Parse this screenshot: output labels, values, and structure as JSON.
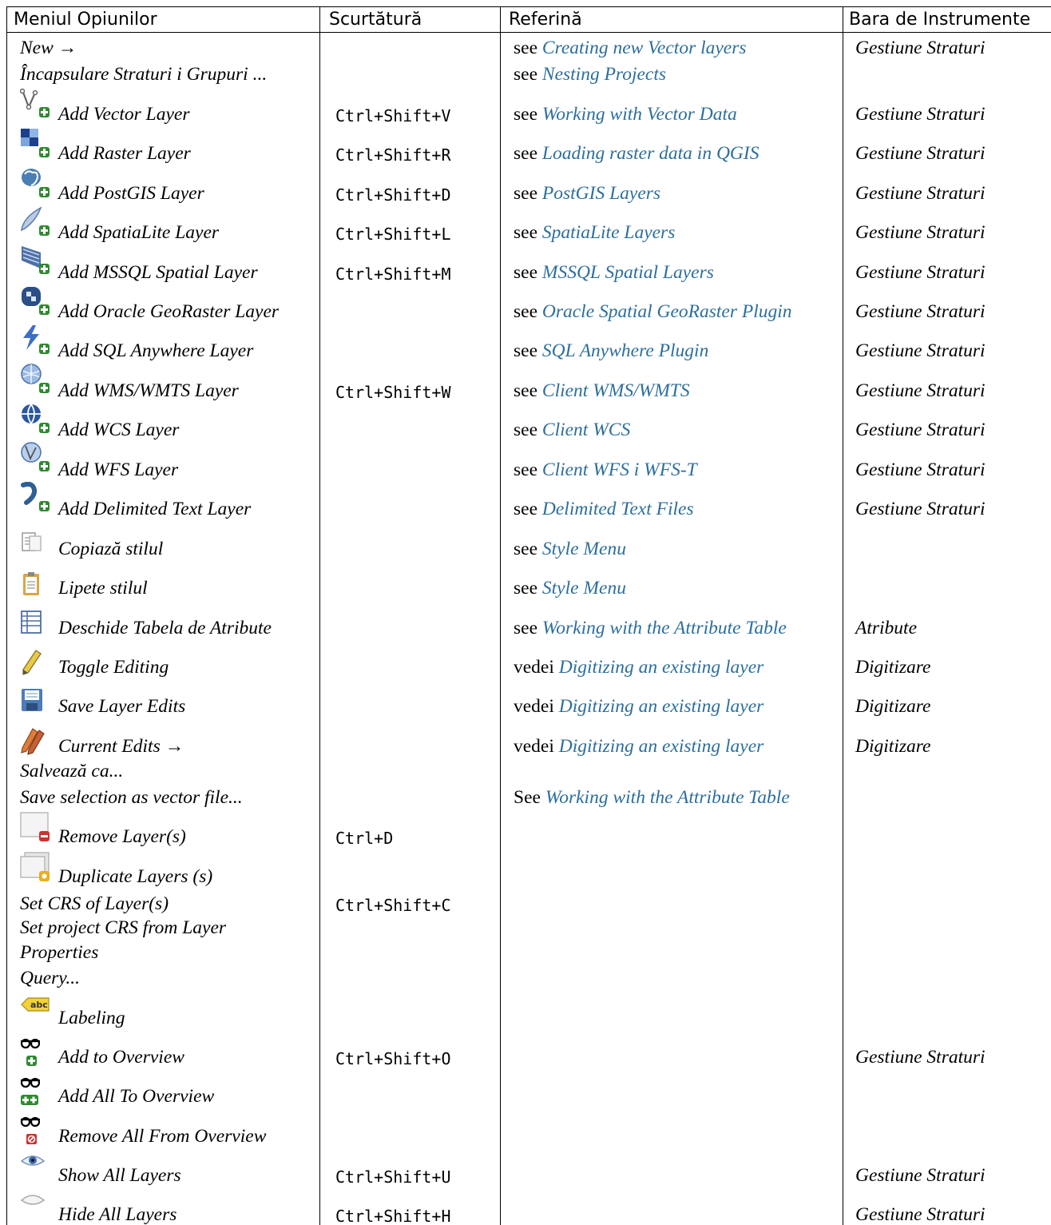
{
  "header": {
    "col1": "Meniul Opiunilor",
    "col2": "Scurtătură",
    "col3": "Referină",
    "col4": "Bara de Instrumente"
  },
  "rows": [
    {
      "label": "New →",
      "shortcut": "",
      "ref_prefix": "see",
      "ref_link": "Creating new Vector layers",
      "toolbar": "Gestiune Straturi",
      "icon": ""
    },
    {
      "label": "Încapsulare Straturi i Grupuri ...",
      "shortcut": "",
      "ref_prefix": "see",
      "ref_link": "Nesting Projects",
      "toolbar": "",
      "icon": ""
    },
    {
      "label": "Add Vector Layer",
      "shortcut": "Ctrl+Shift+V",
      "ref_prefix": "see",
      "ref_link": "Working with Vector Data",
      "toolbar": "Gestiune Straturi",
      "icon": "add-vector-layer-icon"
    },
    {
      "label": "Add Raster Layer",
      "shortcut": "Ctrl+Shift+R",
      "ref_prefix": "see",
      "ref_link": "Loading raster data in QGIS",
      "toolbar": "Gestiune Straturi",
      "icon": "add-raster-layer-icon"
    },
    {
      "label": "Add PostGIS Layer",
      "shortcut": "Ctrl+Shift+D",
      "ref_prefix": "see",
      "ref_link": "PostGIS Layers",
      "toolbar": "Gestiune Straturi",
      "icon": "add-postgis-layer-icon"
    },
    {
      "label": "Add SpatiaLite Layer",
      "shortcut": "Ctrl+Shift+L",
      "ref_prefix": "see",
      "ref_link": "SpatiaLite Layers",
      "toolbar": "Gestiune Straturi",
      "icon": "add-spatialite-layer-icon"
    },
    {
      "label": "Add MSSQL Spatial Layer",
      "shortcut": "Ctrl+Shift+M",
      "ref_prefix": "see",
      "ref_link": "MSSQL Spatial Layers",
      "toolbar": "Gestiune Straturi",
      "icon": "add-mssql-layer-icon"
    },
    {
      "label": "Add Oracle GeoRaster Layer",
      "shortcut": "",
      "ref_prefix": "see",
      "ref_link": "Oracle Spatial GeoRaster Plugin",
      "toolbar": "Gestiune Straturi",
      "icon": "add-oracle-georaster-layer-icon"
    },
    {
      "label": "Add SQL Anywhere Layer",
      "shortcut": "",
      "ref_prefix": "see",
      "ref_link": "SQL Anywhere Plugin",
      "toolbar": "Gestiune Straturi",
      "icon": "add-sql-anywhere-layer-icon"
    },
    {
      "label": "Add WMS/WMTS Layer",
      "shortcut": "Ctrl+Shift+W",
      "ref_prefix": "see",
      "ref_link": "Client WMS/WMTS",
      "toolbar": "Gestiune Straturi",
      "icon": "add-wms-layer-icon"
    },
    {
      "label": "Add WCS Layer",
      "shortcut": "",
      "ref_prefix": "see",
      "ref_link": "Client WCS",
      "toolbar": "Gestiune Straturi",
      "icon": "add-wcs-layer-icon"
    },
    {
      "label": "Add WFS Layer",
      "shortcut": "",
      "ref_prefix": "see",
      "ref_link": "Client WFS i WFS-T",
      "toolbar": "Gestiune Straturi",
      "icon": "add-wfs-layer-icon"
    },
    {
      "label": "Add Delimited Text Layer",
      "shortcut": "",
      "ref_prefix": "see",
      "ref_link": "Delimited Text Files",
      "toolbar": "Gestiune Straturi",
      "icon": "add-delimited-text-layer-icon"
    },
    {
      "label": "Copiază stilul",
      "shortcut": "",
      "ref_prefix": "see",
      "ref_link": "Style Menu",
      "toolbar": "",
      "icon": "copy-style-icon"
    },
    {
      "label": "Lipete stilul",
      "shortcut": "",
      "ref_prefix": "see",
      "ref_link": "Style Menu",
      "toolbar": "",
      "icon": "paste-style-icon"
    },
    {
      "label": "Deschide Tabela de Atribute",
      "shortcut": "",
      "ref_prefix": "see",
      "ref_link": "Working with the Attribute Table",
      "toolbar": "Atribute",
      "icon": "attribute-table-icon"
    },
    {
      "label": "Toggle Editing",
      "shortcut": "",
      "ref_prefix": "vedei",
      "ref_link": "Digitizing an existing layer",
      "toolbar": "Digitizare",
      "icon": "toggle-editing-icon"
    },
    {
      "label": "Save Layer Edits",
      "shortcut": "",
      "ref_prefix": "vedei",
      "ref_link": "Digitizing an existing layer",
      "toolbar": "Digitizare",
      "icon": "save-layer-edits-icon"
    },
    {
      "label": "Current Edits →",
      "shortcut": "",
      "ref_prefix": "vedei",
      "ref_link": "Digitizing an existing layer",
      "toolbar": "Digitizare",
      "icon": "current-edits-icon"
    },
    {
      "label": "Salvează ca...",
      "shortcut": "",
      "ref_prefix": "",
      "ref_link": "",
      "toolbar": "",
      "icon": ""
    },
    {
      "label": "Save selection as vector file...",
      "shortcut": "",
      "ref_prefix": "See",
      "ref_link": "Working with the Attribute Table",
      "toolbar": "",
      "icon": ""
    },
    {
      "label": "Remove Layer(s)",
      "shortcut": "Ctrl+D",
      "ref_prefix": "",
      "ref_link": "",
      "toolbar": "",
      "icon": "remove-layer-icon"
    },
    {
      "label": "Duplicate Layers (s)",
      "shortcut": "",
      "ref_prefix": "",
      "ref_link": "",
      "toolbar": "",
      "icon": "duplicate-layer-icon"
    },
    {
      "label": "Set CRS of Layer(s)",
      "shortcut": "Ctrl+Shift+C",
      "ref_prefix": "",
      "ref_link": "",
      "toolbar": "",
      "icon": ""
    },
    {
      "label": "Set project CRS from Layer",
      "shortcut": "",
      "ref_prefix": "",
      "ref_link": "",
      "toolbar": "",
      "icon": ""
    },
    {
      "label": "Properties",
      "shortcut": "",
      "ref_prefix": "",
      "ref_link": "",
      "toolbar": "",
      "icon": ""
    },
    {
      "label": "Query...",
      "shortcut": "",
      "ref_prefix": "",
      "ref_link": "",
      "toolbar": "",
      "icon": ""
    },
    {
      "label": "Labeling",
      "shortcut": "",
      "ref_prefix": "",
      "ref_link": "",
      "toolbar": "",
      "icon": "labeling-icon",
      "icon_text": "abc"
    },
    {
      "label": "Add to Overview",
      "shortcut": "Ctrl+Shift+O",
      "ref_prefix": "",
      "ref_link": "",
      "toolbar": "Gestiune Straturi",
      "icon": "add-to-overview-icon"
    },
    {
      "label": "Add All To Overview",
      "shortcut": "",
      "ref_prefix": "",
      "ref_link": "",
      "toolbar": "",
      "icon": "add-all-to-overview-icon"
    },
    {
      "label": "Remove All From Overview",
      "shortcut": "",
      "ref_prefix": "",
      "ref_link": "",
      "toolbar": "",
      "icon": "remove-all-from-overview-icon"
    },
    {
      "label": "Show All Layers",
      "shortcut": "Ctrl+Shift+U",
      "ref_prefix": "",
      "ref_link": "",
      "toolbar": "Gestiune Straturi",
      "icon": "show-all-layers-icon"
    },
    {
      "label": "Hide All Layers",
      "shortcut": "Ctrl+Shift+H",
      "ref_prefix": "",
      "ref_link": "",
      "toolbar": "Gestiune Straturi",
      "icon": "hide-all-layers-icon"
    }
  ]
}
